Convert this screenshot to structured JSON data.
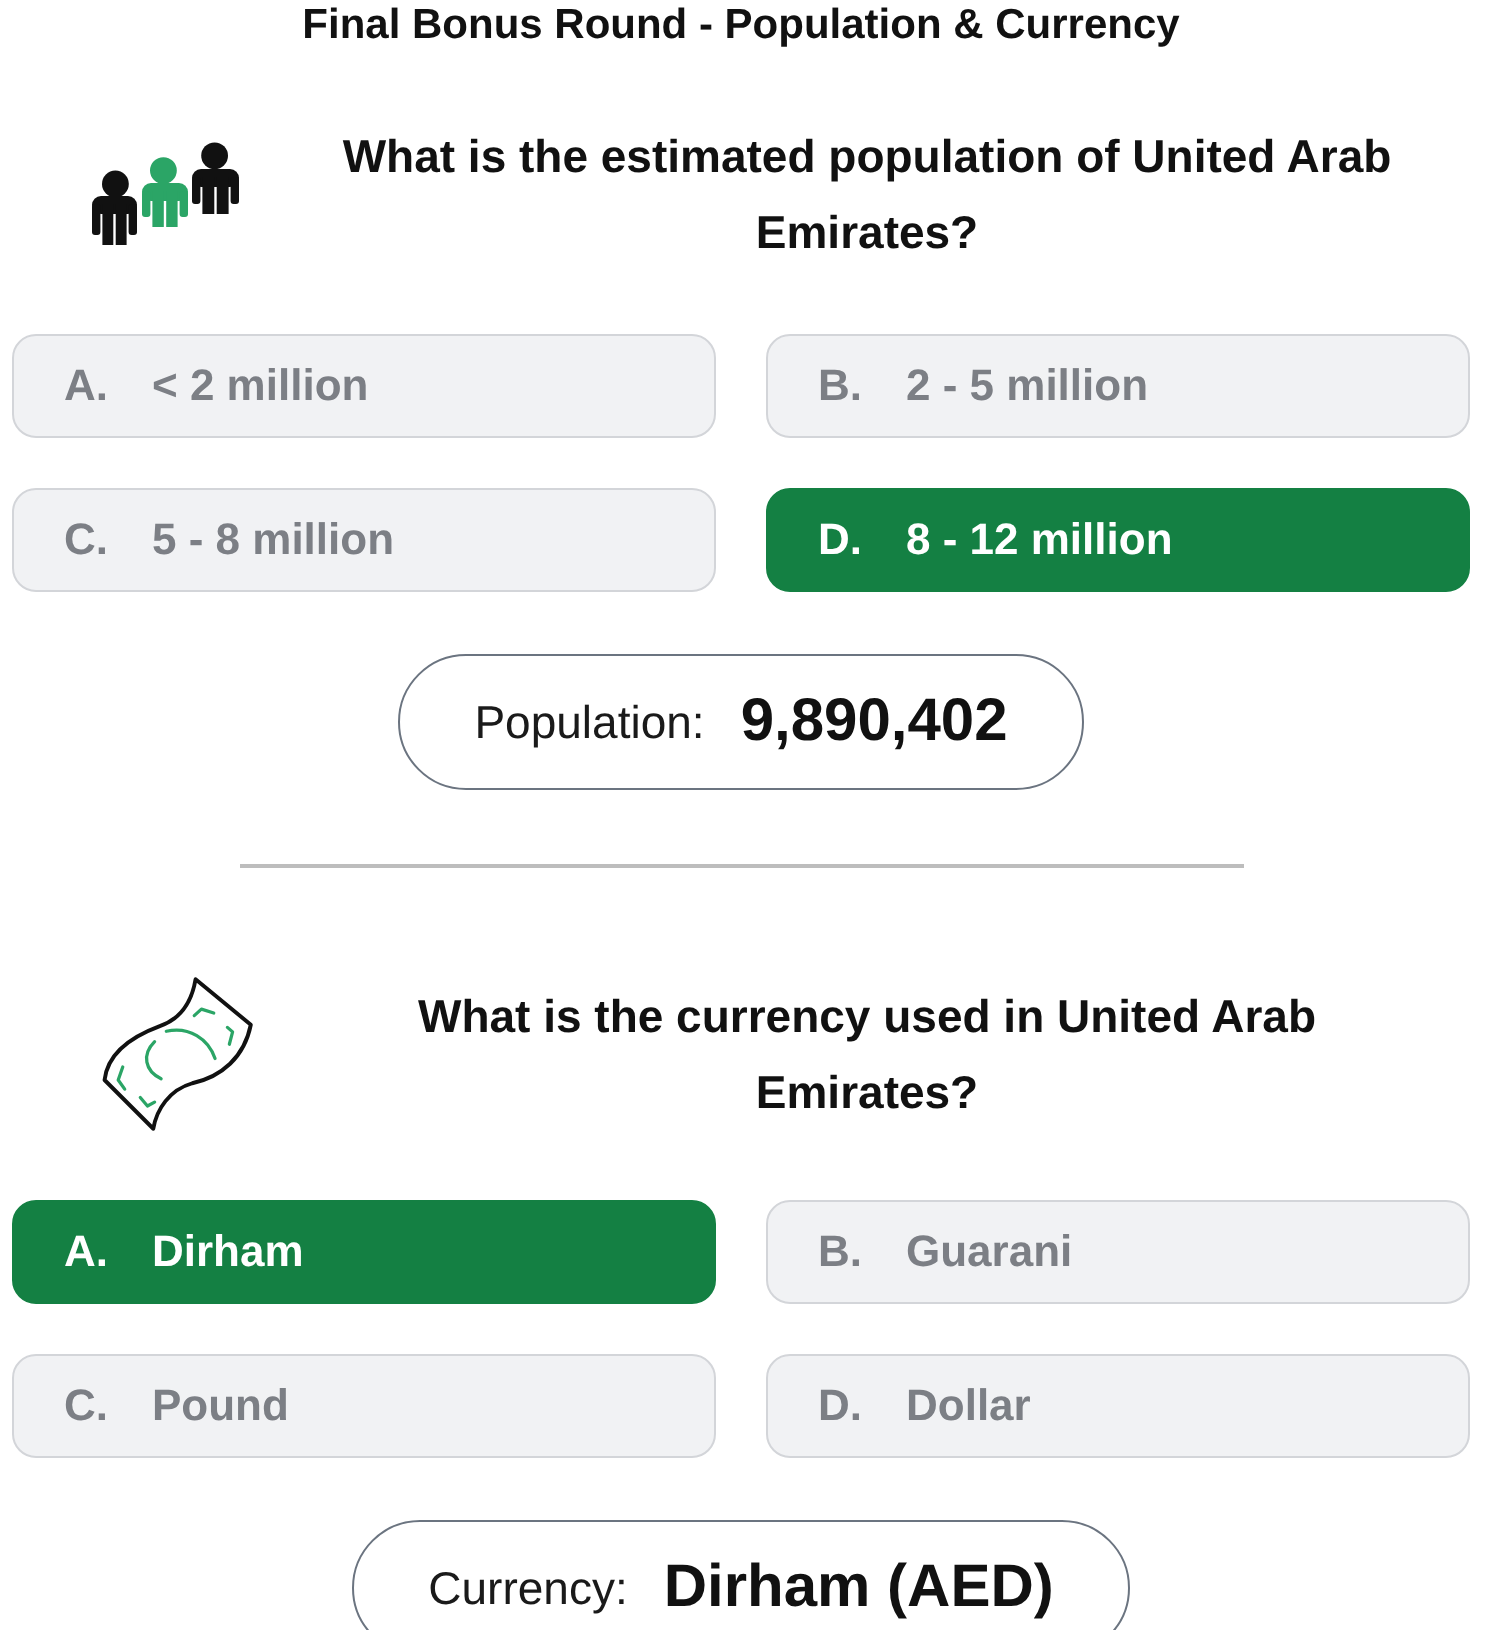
{
  "title": "Final Bonus Round - Population & Currency",
  "questions": [
    {
      "kind": "population",
      "question": "What is the estimated population of United Arab Emirates?",
      "options": [
        {
          "letter": "A.",
          "text": "< 2 million",
          "selected": false
        },
        {
          "letter": "B.",
          "text": "2 - 5 million",
          "selected": false
        },
        {
          "letter": "C.",
          "text": "5 - 8 million",
          "selected": false
        },
        {
          "letter": "D.",
          "text": "8 - 12 million",
          "selected": true
        }
      ],
      "answer": {
        "label": "Population:",
        "value": "9,890,402"
      }
    },
    {
      "kind": "currency",
      "question": "What is the currency used in United Arab Emirates?",
      "options": [
        {
          "letter": "A.",
          "text": "Dirham",
          "selected": true
        },
        {
          "letter": "B.",
          "text": "Guarani",
          "selected": false
        },
        {
          "letter": "C.",
          "text": "Pound",
          "selected": false
        },
        {
          "letter": "D.",
          "text": "Dollar",
          "selected": false
        }
      ],
      "answer": {
        "label": "Currency:",
        "value": "Dirham (AED)"
      }
    }
  ]
}
